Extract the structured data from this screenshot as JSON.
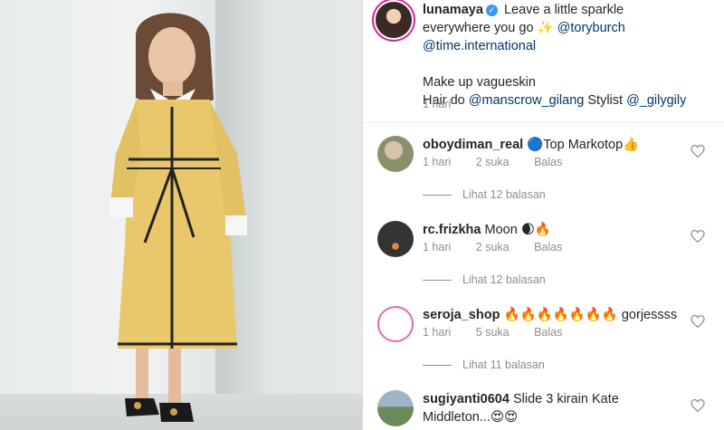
{
  "post": {
    "username": "lunamaya",
    "caption_line1": "Leave a little sparkle",
    "caption_line2": "everywhere you go ✨",
    "mention1": "@toryburch",
    "mention2": "@time.international",
    "makeup": "Make up vagueskin",
    "hair_prefix": "Hair do",
    "hair_mention": "@manscrow_gilang",
    "stylist_label": "Stylist",
    "stylist_mention": "@_gilygily",
    "time": "1 hari"
  },
  "comments": [
    {
      "username": "oboydiman_real",
      "text": "🔵Top Markotop👍",
      "time": "1 hari",
      "likes": "2 suka",
      "reply": "Balas",
      "view_replies": "Lihat 12 balasan"
    },
    {
      "username": "rc.frizkha",
      "text": "Moon 🌒🔥",
      "time": "1 hari",
      "likes": "2 suka",
      "reply": "Balas",
      "view_replies": "Lihat 12 balasan"
    },
    {
      "username": "seroja_shop",
      "text": "🔥🔥🔥🔥🔥🔥🔥 gorjessss",
      "time": "1 hari",
      "likes": "5 suka",
      "reply": "Balas",
      "view_replies": "Lihat 11 balasan"
    },
    {
      "username": "sugiyanti0604",
      "text": "Slide 3 kirain Kate Middleton...😍😍",
      "time": "",
      "likes": "",
      "reply": "",
      "view_replies": ""
    }
  ],
  "icons": {
    "verified": "verified-badge-icon",
    "like": "heart-icon"
  },
  "colors": {
    "link": "#00376b",
    "meta": "#8e8e8e",
    "verified": "#3897f0",
    "dress": "#e8c86a"
  }
}
